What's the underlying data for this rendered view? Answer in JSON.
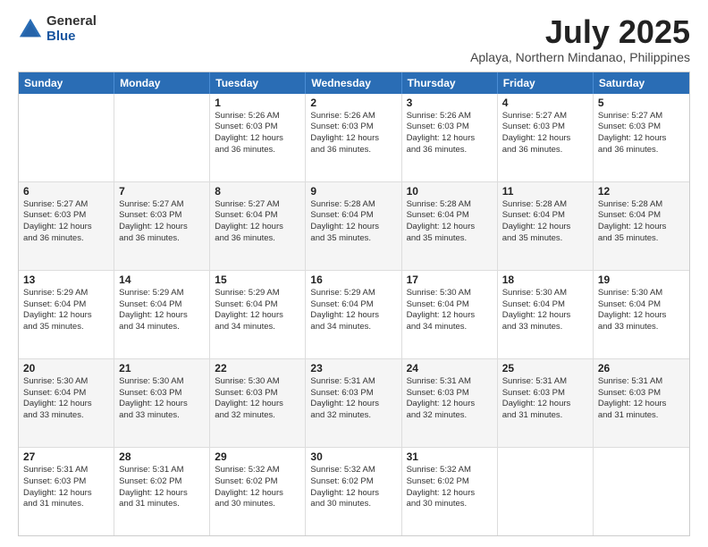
{
  "logo": {
    "general": "General",
    "blue": "Blue"
  },
  "title": "July 2025",
  "location": "Aplaya, Northern Mindanao, Philippines",
  "weekdays": [
    "Sunday",
    "Monday",
    "Tuesday",
    "Wednesday",
    "Thursday",
    "Friday",
    "Saturday"
  ],
  "weeks": [
    [
      {
        "day": "",
        "info": ""
      },
      {
        "day": "",
        "info": ""
      },
      {
        "day": "1",
        "info": "Sunrise: 5:26 AM\nSunset: 6:03 PM\nDaylight: 12 hours\nand 36 minutes."
      },
      {
        "day": "2",
        "info": "Sunrise: 5:26 AM\nSunset: 6:03 PM\nDaylight: 12 hours\nand 36 minutes."
      },
      {
        "day": "3",
        "info": "Sunrise: 5:26 AM\nSunset: 6:03 PM\nDaylight: 12 hours\nand 36 minutes."
      },
      {
        "day": "4",
        "info": "Sunrise: 5:27 AM\nSunset: 6:03 PM\nDaylight: 12 hours\nand 36 minutes."
      },
      {
        "day": "5",
        "info": "Sunrise: 5:27 AM\nSunset: 6:03 PM\nDaylight: 12 hours\nand 36 minutes."
      }
    ],
    [
      {
        "day": "6",
        "info": "Sunrise: 5:27 AM\nSunset: 6:03 PM\nDaylight: 12 hours\nand 36 minutes."
      },
      {
        "day": "7",
        "info": "Sunrise: 5:27 AM\nSunset: 6:03 PM\nDaylight: 12 hours\nand 36 minutes."
      },
      {
        "day": "8",
        "info": "Sunrise: 5:27 AM\nSunset: 6:04 PM\nDaylight: 12 hours\nand 36 minutes."
      },
      {
        "day": "9",
        "info": "Sunrise: 5:28 AM\nSunset: 6:04 PM\nDaylight: 12 hours\nand 35 minutes."
      },
      {
        "day": "10",
        "info": "Sunrise: 5:28 AM\nSunset: 6:04 PM\nDaylight: 12 hours\nand 35 minutes."
      },
      {
        "day": "11",
        "info": "Sunrise: 5:28 AM\nSunset: 6:04 PM\nDaylight: 12 hours\nand 35 minutes."
      },
      {
        "day": "12",
        "info": "Sunrise: 5:28 AM\nSunset: 6:04 PM\nDaylight: 12 hours\nand 35 minutes."
      }
    ],
    [
      {
        "day": "13",
        "info": "Sunrise: 5:29 AM\nSunset: 6:04 PM\nDaylight: 12 hours\nand 35 minutes."
      },
      {
        "day": "14",
        "info": "Sunrise: 5:29 AM\nSunset: 6:04 PM\nDaylight: 12 hours\nand 34 minutes."
      },
      {
        "day": "15",
        "info": "Sunrise: 5:29 AM\nSunset: 6:04 PM\nDaylight: 12 hours\nand 34 minutes."
      },
      {
        "day": "16",
        "info": "Sunrise: 5:29 AM\nSunset: 6:04 PM\nDaylight: 12 hours\nand 34 minutes."
      },
      {
        "day": "17",
        "info": "Sunrise: 5:30 AM\nSunset: 6:04 PM\nDaylight: 12 hours\nand 34 minutes."
      },
      {
        "day": "18",
        "info": "Sunrise: 5:30 AM\nSunset: 6:04 PM\nDaylight: 12 hours\nand 33 minutes."
      },
      {
        "day": "19",
        "info": "Sunrise: 5:30 AM\nSunset: 6:04 PM\nDaylight: 12 hours\nand 33 minutes."
      }
    ],
    [
      {
        "day": "20",
        "info": "Sunrise: 5:30 AM\nSunset: 6:04 PM\nDaylight: 12 hours\nand 33 minutes."
      },
      {
        "day": "21",
        "info": "Sunrise: 5:30 AM\nSunset: 6:03 PM\nDaylight: 12 hours\nand 33 minutes."
      },
      {
        "day": "22",
        "info": "Sunrise: 5:30 AM\nSunset: 6:03 PM\nDaylight: 12 hours\nand 32 minutes."
      },
      {
        "day": "23",
        "info": "Sunrise: 5:31 AM\nSunset: 6:03 PM\nDaylight: 12 hours\nand 32 minutes."
      },
      {
        "day": "24",
        "info": "Sunrise: 5:31 AM\nSunset: 6:03 PM\nDaylight: 12 hours\nand 32 minutes."
      },
      {
        "day": "25",
        "info": "Sunrise: 5:31 AM\nSunset: 6:03 PM\nDaylight: 12 hours\nand 31 minutes."
      },
      {
        "day": "26",
        "info": "Sunrise: 5:31 AM\nSunset: 6:03 PM\nDaylight: 12 hours\nand 31 minutes."
      }
    ],
    [
      {
        "day": "27",
        "info": "Sunrise: 5:31 AM\nSunset: 6:03 PM\nDaylight: 12 hours\nand 31 minutes."
      },
      {
        "day": "28",
        "info": "Sunrise: 5:31 AM\nSunset: 6:02 PM\nDaylight: 12 hours\nand 31 minutes."
      },
      {
        "day": "29",
        "info": "Sunrise: 5:32 AM\nSunset: 6:02 PM\nDaylight: 12 hours\nand 30 minutes."
      },
      {
        "day": "30",
        "info": "Sunrise: 5:32 AM\nSunset: 6:02 PM\nDaylight: 12 hours\nand 30 minutes."
      },
      {
        "day": "31",
        "info": "Sunrise: 5:32 AM\nSunset: 6:02 PM\nDaylight: 12 hours\nand 30 minutes."
      },
      {
        "day": "",
        "info": ""
      },
      {
        "day": "",
        "info": ""
      }
    ]
  ]
}
